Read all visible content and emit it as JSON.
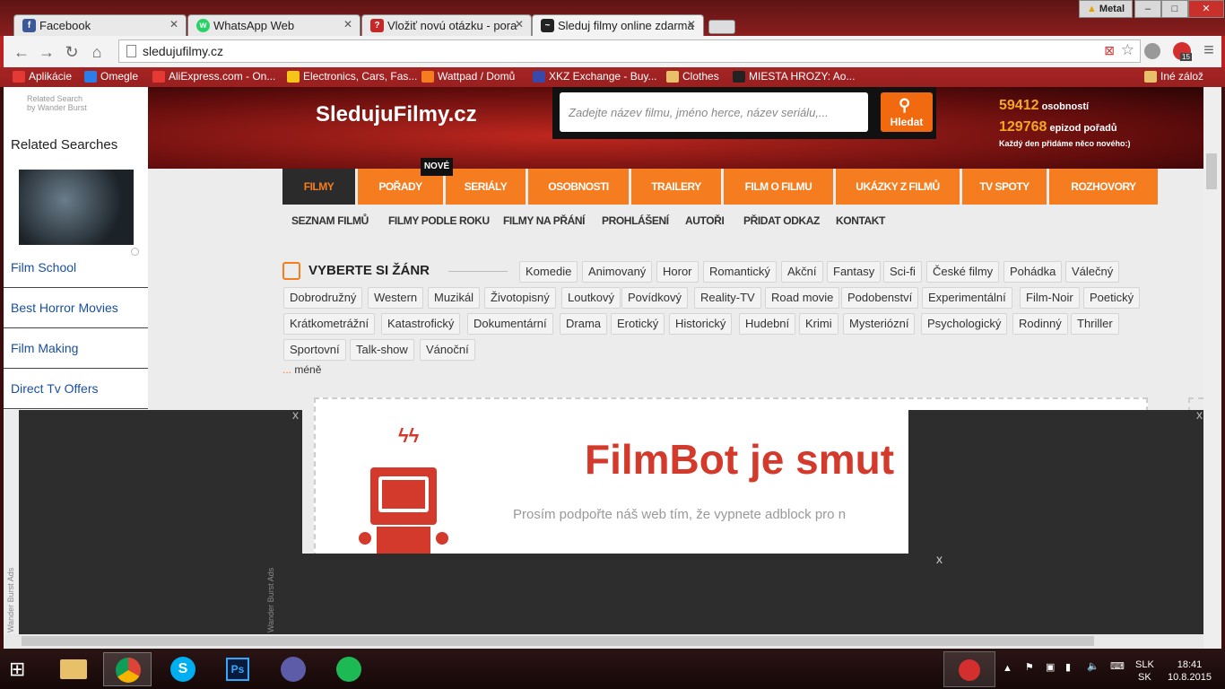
{
  "browser": {
    "tabs": [
      {
        "label": "Facebook",
        "color": "#3b5998",
        "icon": "f"
      },
      {
        "label": "WhatsApp Web",
        "color": "#25d366",
        "icon": "w"
      },
      {
        "label": "Vložiť novú otázku - pora",
        "color": "#c62828",
        "icon": "?"
      },
      {
        "label": "Sleduj filmy online zdarma",
        "color": "#222",
        "icon": "~"
      }
    ],
    "window_user": "Metal",
    "url": "sledujufilmy.cz",
    "extension_badge": "15",
    "bookmarks": [
      {
        "label": "Aplikácie",
        "color": "#e53935"
      },
      {
        "label": "Omegle",
        "color": "#2b7de9"
      },
      {
        "label": "AliExpress.com - On...",
        "color": "#e53935"
      },
      {
        "label": "Electronics, Cars, Fas...",
        "color": "#f5c518"
      },
      {
        "label": "Wattpad / Domů",
        "color": "#f57c1f"
      },
      {
        "label": "XKZ Exchange - Buy...",
        "color": "#3949ab"
      },
      {
        "label": "Clothes",
        "color": "#e8c06a"
      },
      {
        "label": "MIESTA HROZY: Ao...",
        "color": "#222"
      },
      {
        "label": "Iné zálož",
        "color": "#e8c06a"
      }
    ]
  },
  "sidebar": {
    "caption_line1": "Related Search",
    "caption_line2": "by Wander Burst",
    "heading": "Related Searches",
    "items": [
      "Film School",
      "Best Horror Movies",
      "Film Making",
      "Direct Tv Offers"
    ]
  },
  "site": {
    "logo": "SledujuFilmy.cz",
    "search_placeholder": "Zadejte název filmu, jméno herce, název seriálu,...",
    "search_button": "Hledat",
    "stat1_num": "59412",
    "stat1_label": "osobností",
    "stat2_num": "129768",
    "stat2_label": "epizod pořadů",
    "stat_note": "Každý den přidáme něco nového:)",
    "main_nav": [
      "FILMY",
      "POŘADY",
      "SERIÁLY",
      "OSOBNOSTI",
      "TRAILERY",
      "FILM O FILMU",
      "UKÁZKY Z FILMŮ",
      "TV SPOTY",
      "ROZHOVORY"
    ],
    "new_badge": "NOVÉ",
    "sub_nav": [
      "SEZNAM FILMŮ",
      "FILMY PODLE ROKU",
      "FILMY NA PŘÁNÍ",
      "PROHLÁŠENÍ",
      "AUTOŘI",
      "PŘIDAT ODKAZ",
      "KONTAKT"
    ],
    "genre_title": "VYBERTE SI ŽÁNR",
    "genres_row1": [
      "Komedie",
      "Animovaný",
      "Horor",
      "Romantický",
      "Akční",
      "Fantasy",
      "Sci-fi",
      "České filmy",
      "Pohádka",
      "Válečný"
    ],
    "genres_row2": [
      "Dobrodružný",
      "Western",
      "Muzikál",
      "Životopisný",
      "Loutkový",
      "Povídkový",
      "Reality-TV",
      "Road movie",
      "Podobenství",
      "Experimentální",
      "Film-Noir",
      "Poetický"
    ],
    "genres_row3": [
      "Krátkometrážní",
      "Katastrofický",
      "Dokumentární",
      "Drama",
      "Erotický",
      "Historický",
      "Hudební",
      "Krimi",
      "Mysteriózní",
      "Psychologický",
      "Rodinný",
      "Thriller"
    ],
    "genres_row4": [
      "Sportovní",
      "Talk-show",
      "Vánoční"
    ],
    "less_dots": "...",
    "less_label": "méně",
    "filmbot_title": "FilmBot je smut",
    "filmbot_sub": "Prosím podpořte náš web tím, že vypnete adblock pro n"
  },
  "ads": {
    "close": "x",
    "label": "Wander Burst Ads"
  },
  "taskbar": {
    "lang1": "SLK",
    "lang2": "SK",
    "time": "18:41",
    "date": "10.8.2015"
  }
}
